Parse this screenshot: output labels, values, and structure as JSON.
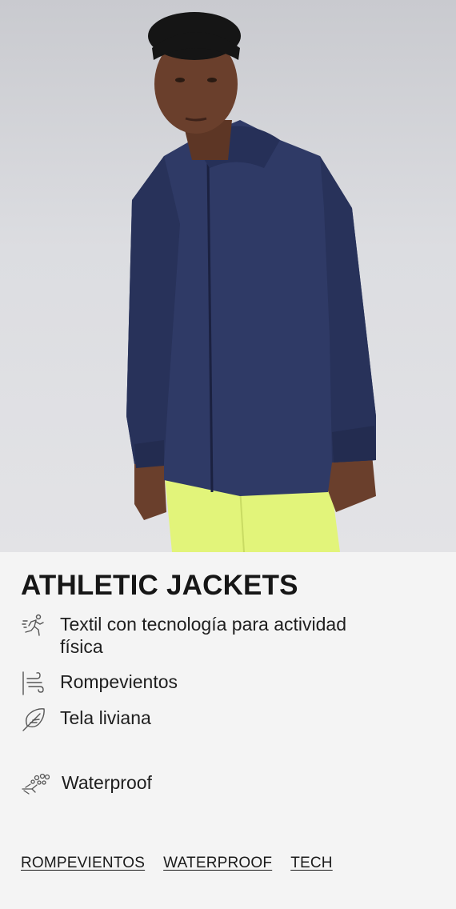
{
  "hero": {
    "image_description": "product-photo"
  },
  "product": {
    "title": "ATHLETIC JACKETS",
    "features": [
      {
        "icon": "running-person-icon",
        "label": "Textil con tecnología para actividad física"
      },
      {
        "icon": "wind-icon",
        "label": "Rompevientos"
      },
      {
        "icon": "feather-icon",
        "label": "Tela liviana"
      },
      {
        "icon": "water-droplets-icon",
        "label": "Waterproof"
      }
    ]
  },
  "tags": [
    {
      "label": "ROMPEVIENTOS"
    },
    {
      "label": "WATERPROOF"
    },
    {
      "label": "TECH"
    }
  ],
  "colors": {
    "background": "#f4f4f4",
    "jacket": "#2f3a66",
    "shorts": "#e2f47a",
    "text": "#1b1b1b"
  }
}
